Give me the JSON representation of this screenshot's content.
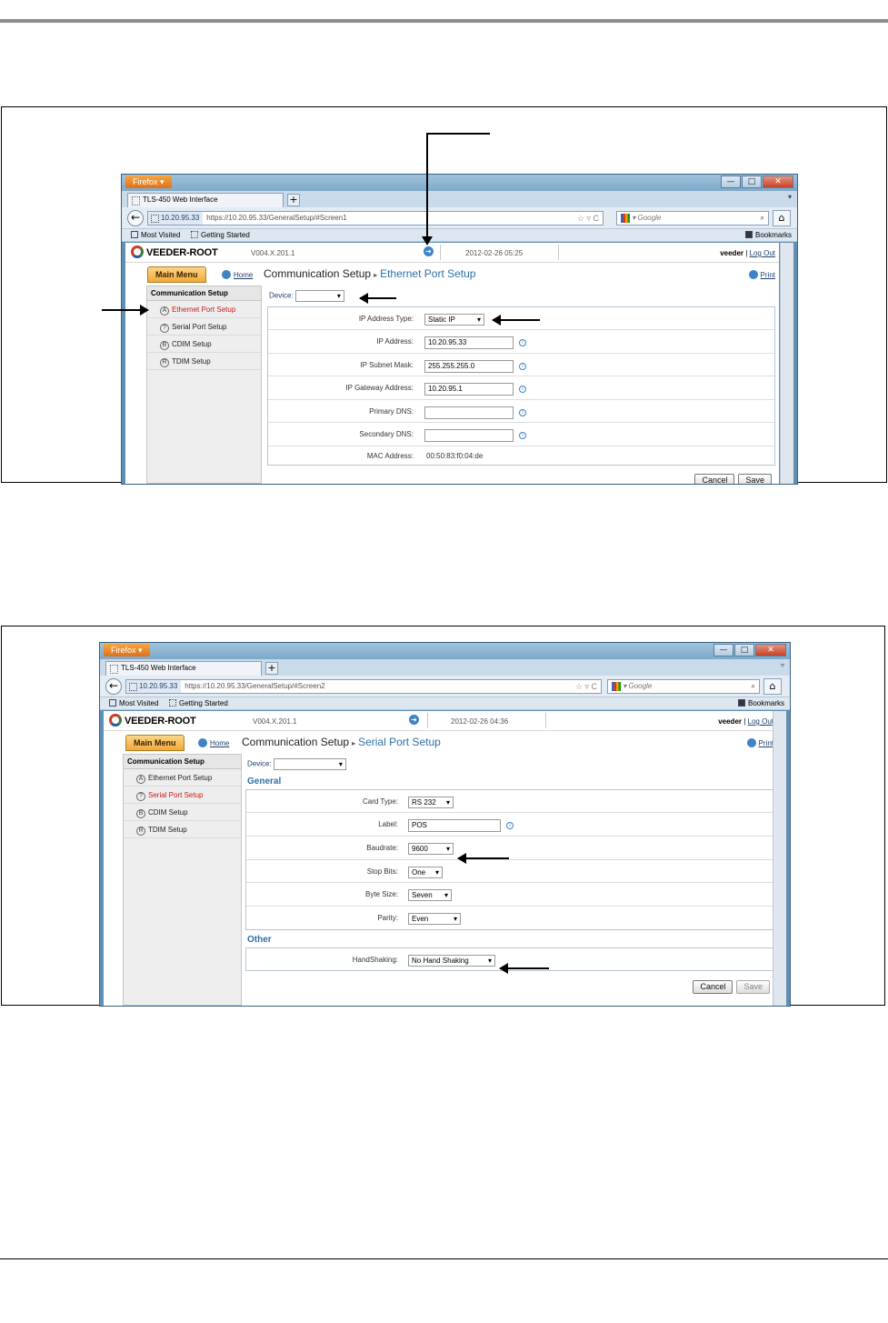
{
  "screen1": {
    "firefox_button": "Firefox",
    "tab_title": "TLS-450 Web Interface",
    "new_tab": "+",
    "url_ip": "10.20.95.33",
    "url_full": "https://10.20.95.33/GeneralSetup/#Screen1",
    "search_placeholder": "Google",
    "bookmarks_bar": {
      "most_visited": "Most Visited",
      "getting_started": "Getting Started",
      "bookmarks": "Bookmarks"
    },
    "logo": "VEEDER-ROOT",
    "version": "V004.X.201.1",
    "datetime": "2012-02-26 05:25",
    "user": "veeder",
    "logout": "Log Out",
    "main_menu": "Main Menu",
    "home": "Home",
    "page_title": "Communication Setup",
    "page_subtitle": "Ethernet Port Setup",
    "print": "Print",
    "sidebar": {
      "heading": "Communication Setup",
      "items": [
        {
          "icon": "A",
          "label": "Ethernet Port Setup",
          "active": true
        },
        {
          "icon": "?",
          "label": "Serial Port Setup",
          "active": false
        },
        {
          "icon": "B",
          "label": "CDIM Setup",
          "active": false
        },
        {
          "icon": "R",
          "label": "TDIM Setup",
          "active": false
        }
      ]
    },
    "device_label": "Device:",
    "device_value": "",
    "fields": [
      {
        "label": "IP Address Type:",
        "type": "select",
        "value": "Static IP"
      },
      {
        "label": "IP Address:",
        "type": "input",
        "value": "10.20.95.33"
      },
      {
        "label": "IP Subnet Mask:",
        "type": "input",
        "value": "255.255.255.0"
      },
      {
        "label": "IP Gateway Address:",
        "type": "input",
        "value": "10.20.95.1"
      },
      {
        "label": "Primary DNS:",
        "type": "input",
        "value": ""
      },
      {
        "label": "Secondary DNS:",
        "type": "input",
        "value": ""
      },
      {
        "label": "MAC Address:",
        "type": "text",
        "value": "00:50:83:f0:04:de"
      }
    ],
    "cancel": "Cancel",
    "save": "Save"
  },
  "screen2": {
    "firefox_button": "Firefox",
    "tab_title": "TLS-450 Web Interface",
    "new_tab": "+",
    "url_ip": "10.20.95.33",
    "url_full": "https://10.20.95.33/GeneralSetup/#Screen2",
    "search_placeholder": "Google",
    "bookmarks_bar": {
      "most_visited": "Most Visited",
      "getting_started": "Getting Started",
      "bookmarks": "Bookmarks"
    },
    "logo": "VEEDER-ROOT",
    "version": "V004.X.201.1",
    "datetime": "2012-02-26 04:36",
    "user": "veeder",
    "logout": "Log Out",
    "main_menu": "Main Menu",
    "home": "Home",
    "page_title": "Communication Setup",
    "page_subtitle": "Serial Port Setup",
    "print": "Print",
    "sidebar": {
      "heading": "Communication Setup",
      "items": [
        {
          "icon": "A",
          "label": "Ethernet Port Setup",
          "active": false
        },
        {
          "icon": "?",
          "label": "Serial Port Setup",
          "active": true
        },
        {
          "icon": "B",
          "label": "CDIM Setup",
          "active": false
        },
        {
          "icon": "R",
          "label": "TDIM Setup",
          "active": false
        }
      ]
    },
    "device_label": "Device:",
    "device_value": "",
    "general_heading": "General",
    "general_fields": [
      {
        "label": "Card Type:",
        "type": "select",
        "value": "RS 232"
      },
      {
        "label": "Label:",
        "type": "input",
        "value": "POS"
      },
      {
        "label": "Baudrate:",
        "type": "select",
        "value": "9600"
      },
      {
        "label": "Stop Bits:",
        "type": "select",
        "value": "One"
      },
      {
        "label": "Byte Size:",
        "type": "select",
        "value": "Seven"
      },
      {
        "label": "Parity:",
        "type": "select",
        "value": "Even"
      }
    ],
    "other_heading": "Other",
    "other_fields": [
      {
        "label": "HandShaking:",
        "type": "select",
        "value": "No Hand Shaking"
      }
    ],
    "cancel": "Cancel",
    "save": "Save"
  },
  "colors": {
    "active_nav": "#c81a1a",
    "link_blue": "#2d6fa8",
    "main_menu_orange": "#f3a83a",
    "firefox_orange": "#e0701a"
  }
}
